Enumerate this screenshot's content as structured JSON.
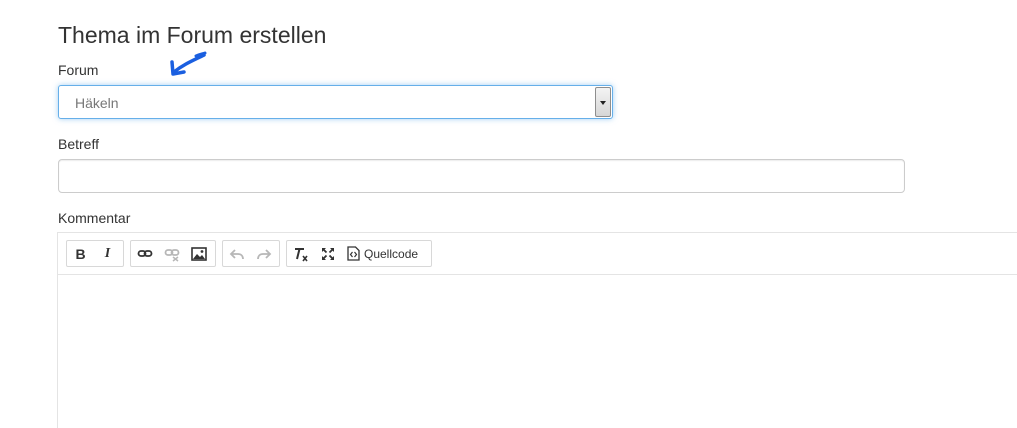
{
  "page": {
    "title": "Thema im Forum erstellen"
  },
  "form": {
    "forum_label": "Forum",
    "forum_value": "Häkeln",
    "subject_label": "Betreff",
    "subject_value": "",
    "comment_label": "Kommentar",
    "comment_value": ""
  },
  "toolbar": {
    "bold_label": "B",
    "italic_label": "I",
    "source_label": "Quellcode",
    "icons": [
      "bold-icon",
      "italic-icon",
      "link-icon",
      "unlink-icon",
      "image-icon",
      "undo-icon",
      "redo-icon",
      "remove-format-icon",
      "maximize-icon",
      "source-icon"
    ]
  },
  "colors": {
    "focus_border": "#66afe9",
    "annotation_arrow": "#1a5fe0"
  }
}
